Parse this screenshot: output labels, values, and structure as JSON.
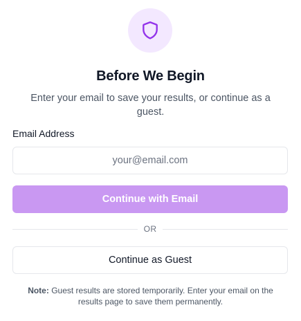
{
  "header": {
    "icon": "shield-icon",
    "title": "Before We Begin",
    "subtitle": "Enter your email to save your results, or continue as a guest."
  },
  "form": {
    "email_label": "Email Address",
    "email_value": "",
    "email_placeholder": "your@email.com",
    "continue_email_label": "Continue with Email",
    "divider_text": "OR",
    "continue_guest_label": "Continue as Guest"
  },
  "note": {
    "prefix": "Note:",
    "text": "Guest results are stored temporarily. Enter your email on the results page to save them permanently."
  },
  "colors": {
    "accent": "#9333ea",
    "accent_light": "#f3e8ff",
    "button_disabled": "#c998f2",
    "border": "#e5e7eb",
    "text_primary": "#111827",
    "text_secondary": "#4b5563"
  }
}
